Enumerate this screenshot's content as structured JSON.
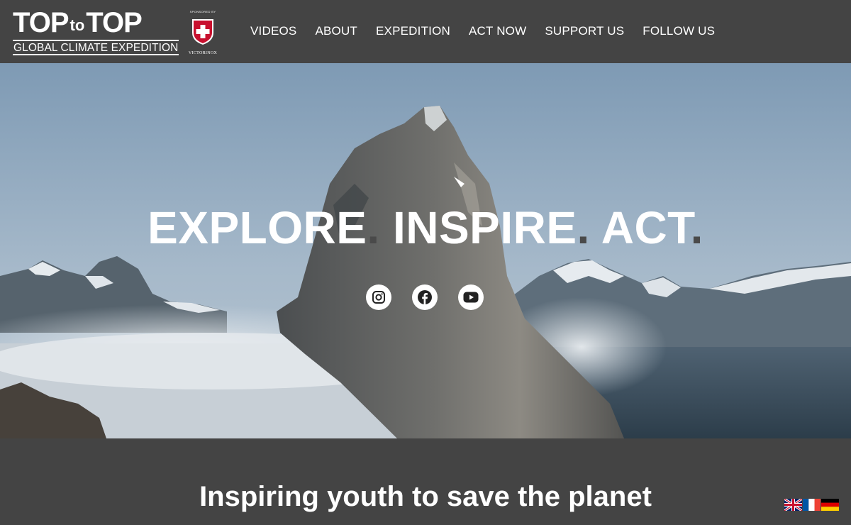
{
  "logo": {
    "top": "TOP",
    "to": "to",
    "top2": "TOP",
    "subtitle": "GLOBAL CLIMATE EXPEDITION"
  },
  "sponsor": {
    "label": "SPONSORED BY",
    "brand": "VICTORINOX"
  },
  "nav": {
    "items": [
      {
        "label": "VIDEOS"
      },
      {
        "label": "ABOUT"
      },
      {
        "label": "EXPEDITION"
      },
      {
        "label": "ACT NOW"
      },
      {
        "label": "SUPPORT US"
      },
      {
        "label": "FOLLOW US"
      }
    ]
  },
  "hero": {
    "words": [
      "EXPLORE",
      "INSPIRE",
      "ACT"
    ],
    "dot": ".",
    "socials": [
      {
        "icon": "instagram-icon"
      },
      {
        "icon": "facebook-icon"
      },
      {
        "icon": "youtube-icon"
      }
    ]
  },
  "section": {
    "title": "Inspiring youth to save the planet"
  },
  "languages": [
    {
      "icon": "uk-flag-icon"
    },
    {
      "icon": "france-flag-icon"
    },
    {
      "icon": "germany-flag-icon"
    }
  ],
  "colors": {
    "header_bg": "#444444",
    "text": "#ffffff",
    "brand_red": "#c8102e"
  }
}
